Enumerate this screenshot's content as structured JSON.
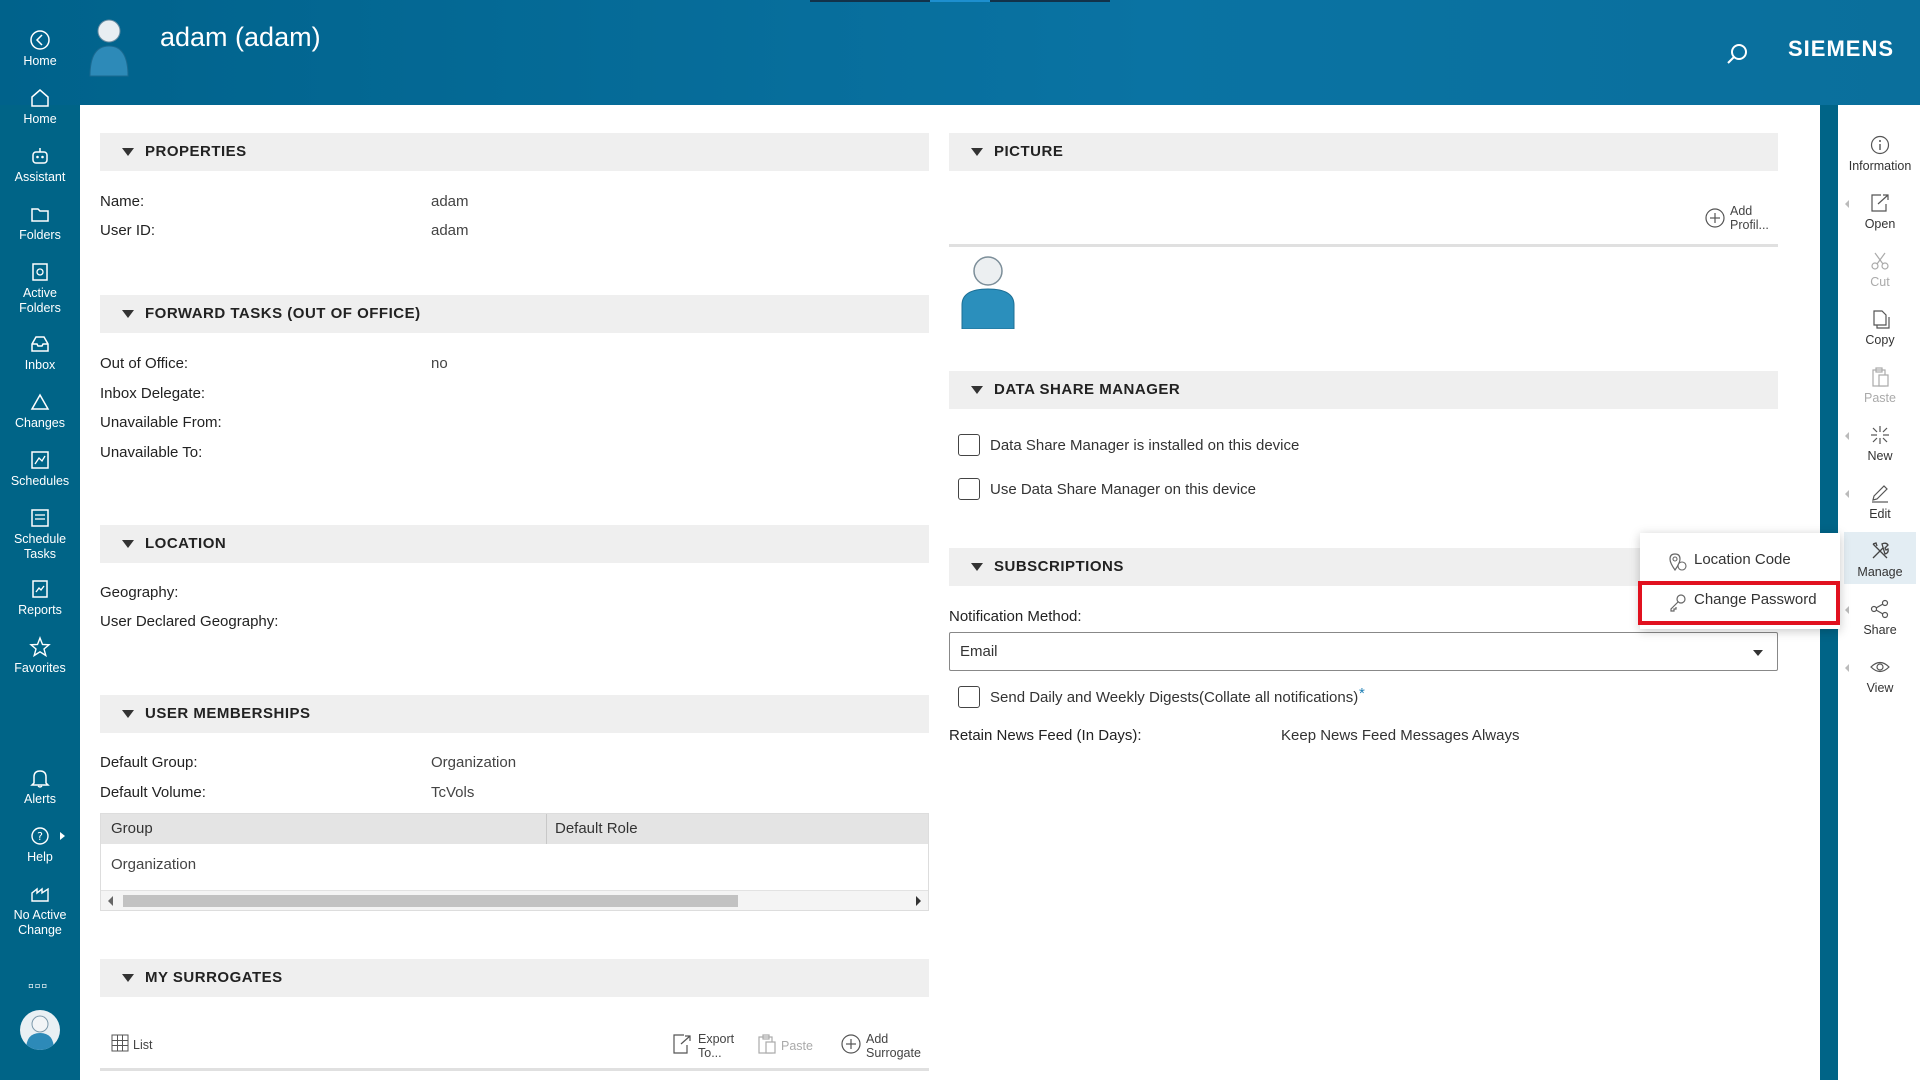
{
  "header": {
    "title": "adam (adam)",
    "brand": "SIEMENS"
  },
  "nav": [
    {
      "label": "Home",
      "icon": "back-arrow-icon"
    },
    {
      "label": "Home",
      "icon": "house-icon"
    },
    {
      "label": "Assistant",
      "icon": "robot-icon"
    },
    {
      "label": "Folders",
      "icon": "folder-icon"
    },
    {
      "label": "Active Folders",
      "icon": "active-folder-icon"
    },
    {
      "label": "Inbox",
      "icon": "inbox-icon"
    },
    {
      "label": "Changes",
      "icon": "triangle-icon"
    },
    {
      "label": "Schedules",
      "icon": "schedule-icon"
    },
    {
      "label": "Schedule Tasks",
      "icon": "schedule-tasks-icon"
    },
    {
      "label": "Reports",
      "icon": "report-icon"
    },
    {
      "label": "Favorites",
      "icon": "star-icon"
    },
    {
      "label": "Alerts",
      "icon": "bell-icon"
    },
    {
      "label": "Help",
      "icon": "help-icon"
    },
    {
      "label": "No Active Change",
      "icon": "change-icon"
    }
  ],
  "properties": {
    "title": "PROPERTIES",
    "name_label": "Name:",
    "name_value": "adam",
    "userid_label": "User ID:",
    "userid_value": "adam"
  },
  "forward_tasks": {
    "title": "FORWARD TASKS (OUT OF OFFICE)",
    "out_label": "Out of Office:",
    "out_value": "no",
    "delegate_label": "Inbox Delegate:",
    "from_label": "Unavailable From:",
    "to_label": "Unavailable To:"
  },
  "location": {
    "title": "LOCATION",
    "geo_label": "Geography:",
    "declared_label": "User Declared Geography:"
  },
  "memberships": {
    "title": "USER MEMBERSHIPS",
    "group_label": "Default Group:",
    "group_value": "Organization",
    "volume_label": "Default Volume:",
    "volume_value": "TcVols",
    "col_group": "Group",
    "col_role": "Default Role",
    "row_group": "Organization"
  },
  "surrogates": {
    "title": "MY SURROGATES",
    "list": "List",
    "export": "Export To...",
    "paste": "Paste",
    "add": "Add Surrogate"
  },
  "picture": {
    "title": "PICTURE",
    "add_profile": "Add Profil..."
  },
  "dsm": {
    "title": "DATA SHARE MANAGER",
    "installed": "Data Share Manager is installed on this device",
    "use": "Use Data Share Manager on this device"
  },
  "subscriptions": {
    "title": "SUBSCRIPTIONS",
    "method_label": "Notification Method:",
    "method_value": "Email",
    "digest": "Send Daily and Weekly Digests(Collate all notifications)",
    "required_mark": "*",
    "retain_label": "Retain News Feed (In Days):",
    "retain_value": "Keep News Feed Messages Always"
  },
  "rightbar": [
    {
      "label": "Information",
      "icon": "info-icon",
      "enabled": true
    },
    {
      "label": "Open",
      "icon": "open-icon",
      "enabled": true
    },
    {
      "label": "Cut",
      "icon": "scissors-icon",
      "enabled": false
    },
    {
      "label": "Copy",
      "icon": "copy-icon",
      "enabled": true
    },
    {
      "label": "Paste",
      "icon": "paste-icon",
      "enabled": false
    },
    {
      "label": "New",
      "icon": "new-icon",
      "enabled": true
    },
    {
      "label": "Edit",
      "icon": "pencil-icon",
      "enabled": true
    },
    {
      "label": "Manage",
      "icon": "tools-icon",
      "enabled": true
    },
    {
      "label": "Share",
      "icon": "share-icon",
      "enabled": true
    },
    {
      "label": "View",
      "icon": "eye-icon",
      "enabled": true
    }
  ],
  "popup": {
    "location_code": "Location Code",
    "change_password": "Change Password"
  },
  "colors": {
    "header": "#0a73a3",
    "nav": "#006487",
    "highlight": "#e1111f"
  }
}
